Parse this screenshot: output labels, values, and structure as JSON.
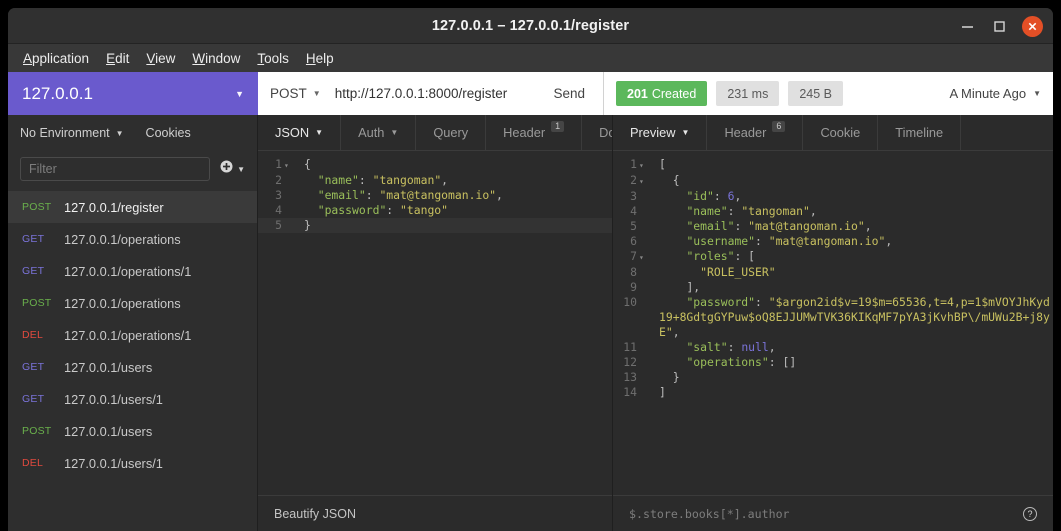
{
  "window": {
    "title": "127.0.0.1 – 127.0.0.1/register",
    "minimize_icon": "minimize-icon",
    "maximize_icon": "maximize-icon",
    "close_icon": "close-icon"
  },
  "menubar": {
    "items": [
      {
        "label": "Application",
        "mnemonic": "A"
      },
      {
        "label": "Edit",
        "mnemonic": "E"
      },
      {
        "label": "View",
        "mnemonic": "V"
      },
      {
        "label": "Window",
        "mnemonic": "W"
      },
      {
        "label": "Tools",
        "mnemonic": "T"
      },
      {
        "label": "Help",
        "mnemonic": "H"
      }
    ]
  },
  "workspace": {
    "name": "127.0.0.1",
    "caret": "▼",
    "color": "#6a5acd"
  },
  "request_bar": {
    "method": "POST",
    "method_caret": "▼",
    "url": "http://127.0.0.1:8000/register",
    "send_label": "Send"
  },
  "response_bar": {
    "status_code": "201",
    "status_text": "Created",
    "status_color": "#5cb85c",
    "time": "231 ms",
    "size": "245 B",
    "ago": "A Minute Ago",
    "ago_caret": "▼"
  },
  "sidebar": {
    "environment": "No Environment",
    "environment_caret": "▼",
    "cookies_label": "Cookies",
    "filter_placeholder": "Filter",
    "filter_value": "",
    "add_icon": "plus-circle-icon",
    "add_caret": "▼",
    "requests": [
      {
        "method": "POST",
        "name": "127.0.0.1/register",
        "active": true
      },
      {
        "method": "GET",
        "name": "127.0.0.1/operations",
        "active": false
      },
      {
        "method": "GET",
        "name": "127.0.0.1/operations/1",
        "active": false
      },
      {
        "method": "POST",
        "name": "127.0.0.1/operations",
        "active": false
      },
      {
        "method": "DEL",
        "name": "127.0.0.1/operations/1",
        "active": false
      },
      {
        "method": "GET",
        "name": "127.0.0.1/users",
        "active": false
      },
      {
        "method": "GET",
        "name": "127.0.0.1/users/1",
        "active": false
      },
      {
        "method": "POST",
        "name": "127.0.0.1/users",
        "active": false
      },
      {
        "method": "DEL",
        "name": "127.0.0.1/users/1",
        "active": false
      }
    ]
  },
  "request_panel": {
    "tabs": [
      {
        "label": "JSON",
        "caret": "▼",
        "selected": true,
        "badge": ""
      },
      {
        "label": "Auth",
        "caret": "▼",
        "selected": false,
        "badge": ""
      },
      {
        "label": "Query",
        "caret": "",
        "selected": false,
        "badge": ""
      },
      {
        "label": "Header",
        "caret": "",
        "selected": false,
        "badge": "1"
      },
      {
        "label": "Doc",
        "caret": "",
        "selected": false,
        "badge": ""
      }
    ],
    "lines": [
      {
        "no": "1",
        "fold": "▾",
        "text": "{",
        "highlight": false
      },
      {
        "no": "2",
        "fold": "",
        "text": "  \"name\": \"tangoman\",",
        "highlight": false
      },
      {
        "no": "3",
        "fold": "",
        "text": "  \"email\": \"mat@tangoman.io\",",
        "highlight": false
      },
      {
        "no": "4",
        "fold": "",
        "text": "  \"password\": \"tango\"",
        "highlight": false
      },
      {
        "no": "5",
        "fold": "",
        "text": "}",
        "highlight": true
      }
    ],
    "statusbar": "Beautify JSON"
  },
  "response_panel": {
    "tabs": [
      {
        "label": "Preview",
        "caret": "▼",
        "selected": true,
        "badge": ""
      },
      {
        "label": "Header",
        "caret": "",
        "selected": false,
        "badge": "6"
      },
      {
        "label": "Cookie",
        "caret": "",
        "selected": false,
        "badge": ""
      },
      {
        "label": "Timeline",
        "caret": "",
        "selected": false,
        "badge": ""
      }
    ],
    "lines": [
      {
        "no": "1",
        "fold": "▾",
        "text": "["
      },
      {
        "no": "2",
        "fold": "▾",
        "text": "  {"
      },
      {
        "no": "3",
        "fold": "",
        "text": "    \"id\": 6,"
      },
      {
        "no": "4",
        "fold": "",
        "text": "    \"name\": \"tangoman\","
      },
      {
        "no": "5",
        "fold": "",
        "text": "    \"email\": \"mat@tangoman.io\","
      },
      {
        "no": "6",
        "fold": "",
        "text": "    \"username\": \"mat@tangoman.io\","
      },
      {
        "no": "7",
        "fold": "▾",
        "text": "    \"roles\": ["
      },
      {
        "no": "8",
        "fold": "",
        "text": "      \"ROLE_USER\""
      },
      {
        "no": "9",
        "fold": "",
        "text": "    ],"
      },
      {
        "no": "10",
        "fold": "",
        "text": "    \"password\": \"$argon2id$v=19$m=65536,t=4,p=1$mVOYJhKyd19+8GdtgGYPuw$oQ8EJJUMwTVK36KIKqMF7pYA3jKvhBP\\/mUWu2B+j8yE\","
      },
      {
        "no": "11",
        "fold": "",
        "text": "    \"salt\": null,"
      },
      {
        "no": "12",
        "fold": "",
        "text": "    \"operations\": []"
      },
      {
        "no": "13",
        "fold": "",
        "text": "  }"
      },
      {
        "no": "14",
        "fold": "",
        "text": "]"
      }
    ],
    "filter_placeholder": "$.store.books[*].author",
    "filter_value": "",
    "help_icon": "help-circle-icon"
  }
}
